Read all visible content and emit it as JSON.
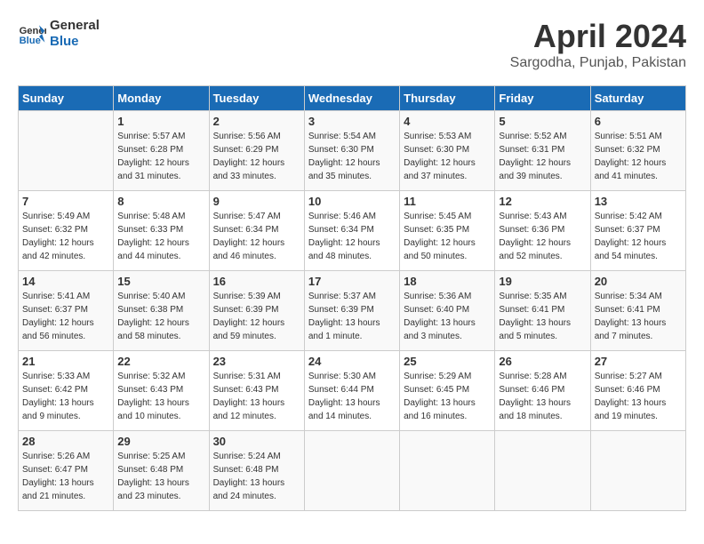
{
  "header": {
    "logo_line1": "General",
    "logo_line2": "Blue",
    "month_year": "April 2024",
    "location": "Sargodha, Punjab, Pakistan"
  },
  "weekdays": [
    "Sunday",
    "Monday",
    "Tuesday",
    "Wednesday",
    "Thursday",
    "Friday",
    "Saturday"
  ],
  "weeks": [
    [
      {
        "day": "",
        "info": ""
      },
      {
        "day": "1",
        "info": "Sunrise: 5:57 AM\nSunset: 6:28 PM\nDaylight: 12 hours\nand 31 minutes."
      },
      {
        "day": "2",
        "info": "Sunrise: 5:56 AM\nSunset: 6:29 PM\nDaylight: 12 hours\nand 33 minutes."
      },
      {
        "day": "3",
        "info": "Sunrise: 5:54 AM\nSunset: 6:30 PM\nDaylight: 12 hours\nand 35 minutes."
      },
      {
        "day": "4",
        "info": "Sunrise: 5:53 AM\nSunset: 6:30 PM\nDaylight: 12 hours\nand 37 minutes."
      },
      {
        "day": "5",
        "info": "Sunrise: 5:52 AM\nSunset: 6:31 PM\nDaylight: 12 hours\nand 39 minutes."
      },
      {
        "day": "6",
        "info": "Sunrise: 5:51 AM\nSunset: 6:32 PM\nDaylight: 12 hours\nand 41 minutes."
      }
    ],
    [
      {
        "day": "7",
        "info": "Sunrise: 5:49 AM\nSunset: 6:32 PM\nDaylight: 12 hours\nand 42 minutes."
      },
      {
        "day": "8",
        "info": "Sunrise: 5:48 AM\nSunset: 6:33 PM\nDaylight: 12 hours\nand 44 minutes."
      },
      {
        "day": "9",
        "info": "Sunrise: 5:47 AM\nSunset: 6:34 PM\nDaylight: 12 hours\nand 46 minutes."
      },
      {
        "day": "10",
        "info": "Sunrise: 5:46 AM\nSunset: 6:34 PM\nDaylight: 12 hours\nand 48 minutes."
      },
      {
        "day": "11",
        "info": "Sunrise: 5:45 AM\nSunset: 6:35 PM\nDaylight: 12 hours\nand 50 minutes."
      },
      {
        "day": "12",
        "info": "Sunrise: 5:43 AM\nSunset: 6:36 PM\nDaylight: 12 hours\nand 52 minutes."
      },
      {
        "day": "13",
        "info": "Sunrise: 5:42 AM\nSunset: 6:37 PM\nDaylight: 12 hours\nand 54 minutes."
      }
    ],
    [
      {
        "day": "14",
        "info": "Sunrise: 5:41 AM\nSunset: 6:37 PM\nDaylight: 12 hours\nand 56 minutes."
      },
      {
        "day": "15",
        "info": "Sunrise: 5:40 AM\nSunset: 6:38 PM\nDaylight: 12 hours\nand 58 minutes."
      },
      {
        "day": "16",
        "info": "Sunrise: 5:39 AM\nSunset: 6:39 PM\nDaylight: 12 hours\nand 59 minutes."
      },
      {
        "day": "17",
        "info": "Sunrise: 5:37 AM\nSunset: 6:39 PM\nDaylight: 13 hours\nand 1 minute."
      },
      {
        "day": "18",
        "info": "Sunrise: 5:36 AM\nSunset: 6:40 PM\nDaylight: 13 hours\nand 3 minutes."
      },
      {
        "day": "19",
        "info": "Sunrise: 5:35 AM\nSunset: 6:41 PM\nDaylight: 13 hours\nand 5 minutes."
      },
      {
        "day": "20",
        "info": "Sunrise: 5:34 AM\nSunset: 6:41 PM\nDaylight: 13 hours\nand 7 minutes."
      }
    ],
    [
      {
        "day": "21",
        "info": "Sunrise: 5:33 AM\nSunset: 6:42 PM\nDaylight: 13 hours\nand 9 minutes."
      },
      {
        "day": "22",
        "info": "Sunrise: 5:32 AM\nSunset: 6:43 PM\nDaylight: 13 hours\nand 10 minutes."
      },
      {
        "day": "23",
        "info": "Sunrise: 5:31 AM\nSunset: 6:43 PM\nDaylight: 13 hours\nand 12 minutes."
      },
      {
        "day": "24",
        "info": "Sunrise: 5:30 AM\nSunset: 6:44 PM\nDaylight: 13 hours\nand 14 minutes."
      },
      {
        "day": "25",
        "info": "Sunrise: 5:29 AM\nSunset: 6:45 PM\nDaylight: 13 hours\nand 16 minutes."
      },
      {
        "day": "26",
        "info": "Sunrise: 5:28 AM\nSunset: 6:46 PM\nDaylight: 13 hours\nand 18 minutes."
      },
      {
        "day": "27",
        "info": "Sunrise: 5:27 AM\nSunset: 6:46 PM\nDaylight: 13 hours\nand 19 minutes."
      }
    ],
    [
      {
        "day": "28",
        "info": "Sunrise: 5:26 AM\nSunset: 6:47 PM\nDaylight: 13 hours\nand 21 minutes."
      },
      {
        "day": "29",
        "info": "Sunrise: 5:25 AM\nSunset: 6:48 PM\nDaylight: 13 hours\nand 23 minutes."
      },
      {
        "day": "30",
        "info": "Sunrise: 5:24 AM\nSunset: 6:48 PM\nDaylight: 13 hours\nand 24 minutes."
      },
      {
        "day": "",
        "info": ""
      },
      {
        "day": "",
        "info": ""
      },
      {
        "day": "",
        "info": ""
      },
      {
        "day": "",
        "info": ""
      }
    ]
  ]
}
